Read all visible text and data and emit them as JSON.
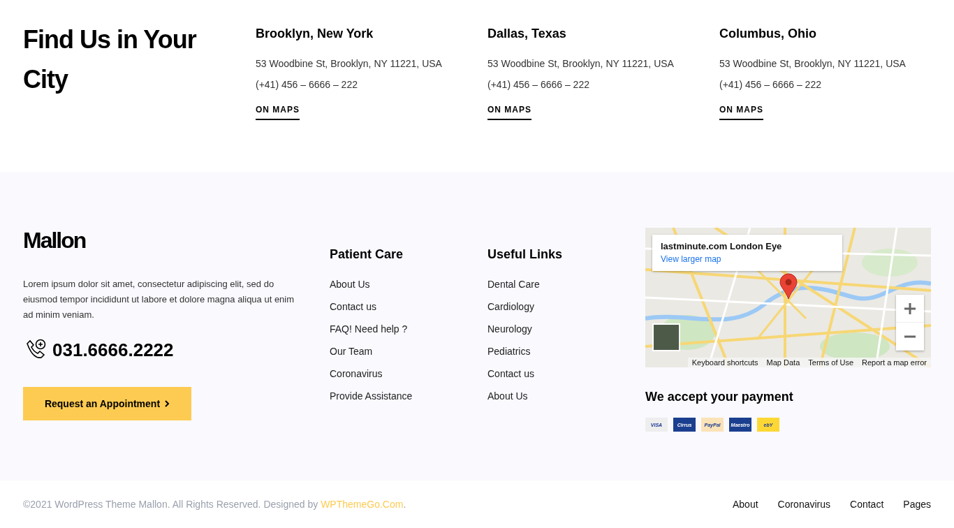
{
  "locations": {
    "heading": "Find Us in Your City",
    "items": [
      {
        "city": "Brooklyn, New York",
        "address": "53 Woodbine St, Brooklyn, NY 11221, USA",
        "phone": "(+41) 456 – 6666 – 222",
        "link": "ON MAPS"
      },
      {
        "city": "Dallas, Texas",
        "address": "53 Woodbine St, Brooklyn, NY 11221, USA",
        "phone": "(+41) 456 – 6666 – 222",
        "link": "ON MAPS"
      },
      {
        "city": "Columbus, Ohio",
        "address": "53 Woodbine St, Brooklyn, NY 11221, USA",
        "phone": "(+41) 456 – 6666 – 222",
        "link": "ON MAPS"
      }
    ]
  },
  "footer": {
    "logo": "Mallon",
    "about": "Lorem ipsum dolor sit amet, consectetur adipiscing elit, sed do eiusmod tempor incididunt ut labore et dolore magna aliqua ut enim ad minim veniam.",
    "phone": "031.6666.2222",
    "button": "Request an Appointment",
    "columns": [
      {
        "title": "Patient Care",
        "links": [
          "About Us",
          "Contact us",
          "FAQ! Need help ?",
          "Our Team",
          "Coronavirus",
          "Provide Assistance"
        ]
      },
      {
        "title": "Useful Links",
        "links": [
          "Dental Care",
          "Cardiology",
          "Neurology",
          "Pediatrics",
          "Contact us",
          "About Us"
        ]
      }
    ],
    "map": {
      "place": "lastminute.com London Eye",
      "larger": "View larger map",
      "attribution": [
        "Keyboard shortcuts",
        "Map Data",
        "Terms of Use",
        "Report a map error"
      ]
    },
    "payment": {
      "title": "We accept your payment",
      "cards": [
        {
          "label": "VISA",
          "color": "#eeeeee"
        },
        {
          "label": "Cirrus",
          "color": "#1b3f8f"
        },
        {
          "label": "PayPal",
          "color": "#fbe3b8"
        },
        {
          "label": "Maestro",
          "color": "#1b3f8f"
        },
        {
          "label": "ebY",
          "color": "#fdd835"
        }
      ]
    }
  },
  "bottom": {
    "copyright": "©2021 WordPress Theme Mallon. All Rights Reserved. Designed by",
    "designer": "WPThemeGo.Com",
    "period": ".",
    "links": [
      "About",
      "Coronavirus",
      "Contact",
      "Pages"
    ]
  }
}
